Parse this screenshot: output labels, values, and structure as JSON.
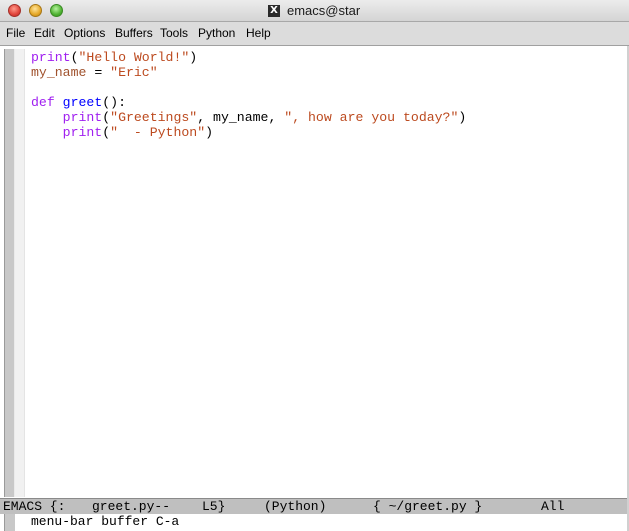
{
  "window": {
    "title": "emacs@star",
    "x11_glyph": "X"
  },
  "menubar": {
    "items": [
      "File",
      "Edit",
      "Options",
      "Buffers",
      "Tools",
      "Python",
      "Help"
    ]
  },
  "editor": {
    "language": "python",
    "lines": [
      [
        {
          "t": "print",
          "c": "kw"
        },
        {
          "t": "(",
          "c": "plain"
        },
        {
          "t": "\"Hello World!\"",
          "c": "str"
        },
        {
          "t": ")",
          "c": "plain"
        }
      ],
      [
        {
          "t": "my_name",
          "c": "var"
        },
        {
          "t": " = ",
          "c": "plain"
        },
        {
          "t": "\"Eric\"",
          "c": "str"
        }
      ],
      [],
      [
        {
          "t": "def",
          "c": "kw"
        },
        {
          "t": " ",
          "c": "plain"
        },
        {
          "t": "greet",
          "c": "fn"
        },
        {
          "t": "():",
          "c": "plain"
        }
      ],
      [
        {
          "t": "    ",
          "c": "plain"
        },
        {
          "t": "print",
          "c": "kw"
        },
        {
          "t": "(",
          "c": "plain"
        },
        {
          "t": "\"Greetings\"",
          "c": "str"
        },
        {
          "t": ", my_name, ",
          "c": "plain"
        },
        {
          "t": "\", how are you today?\"",
          "c": "str"
        },
        {
          "t": ")",
          "c": "plain"
        }
      ],
      [
        {
          "t": "    ",
          "c": "plain"
        },
        {
          "t": "print",
          "c": "kw"
        },
        {
          "t": "(",
          "c": "plain"
        },
        {
          "t": "\"  - Python\"",
          "c": "str"
        },
        {
          "t": ")",
          "c": "plain"
        }
      ]
    ]
  },
  "modeline": {
    "prefix": "EMACS {:",
    "buffer": "greet.py--",
    "line": "L5}",
    "mode": "(Python)",
    "path": "{ ~/greet.py }",
    "position": "All"
  },
  "minibuffer": {
    "text": "menu-bar buffer C-a"
  },
  "colors": {
    "keyword": "#a020f0",
    "string": "#bc4a1f",
    "function": "#0000ff",
    "variable": "#a0522d",
    "modeline_bg": "#bfbfbf"
  }
}
